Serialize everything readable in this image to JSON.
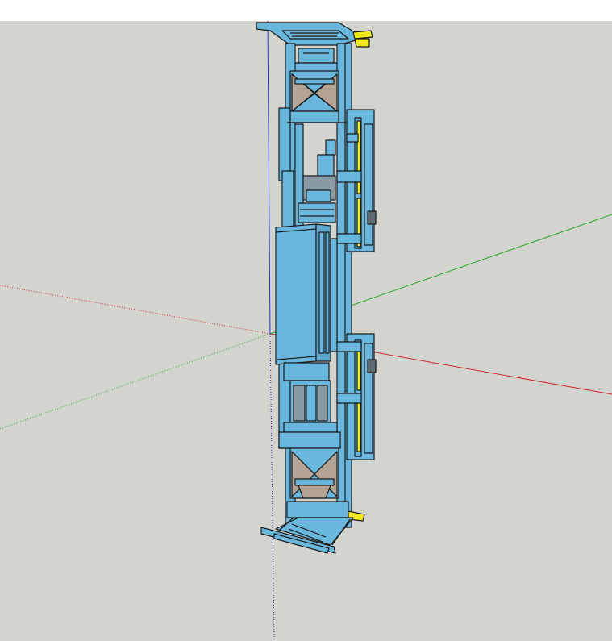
{
  "app": {
    "name": "",
    "view": "3D modeling viewport"
  },
  "viewport": {
    "background": "#d4d4cf",
    "axes": {
      "red_color": "#cc2a2a",
      "green_color": "#2aa52a",
      "blue_color": "#2a2acc"
    },
    "model": {
      "primary_color": "#6ab7dd",
      "outline_color": "#1a1a1a",
      "accent_color": "#f2ea1a",
      "brace_color": "#b4a496",
      "metal_color": "#8a9aa4"
    }
  }
}
